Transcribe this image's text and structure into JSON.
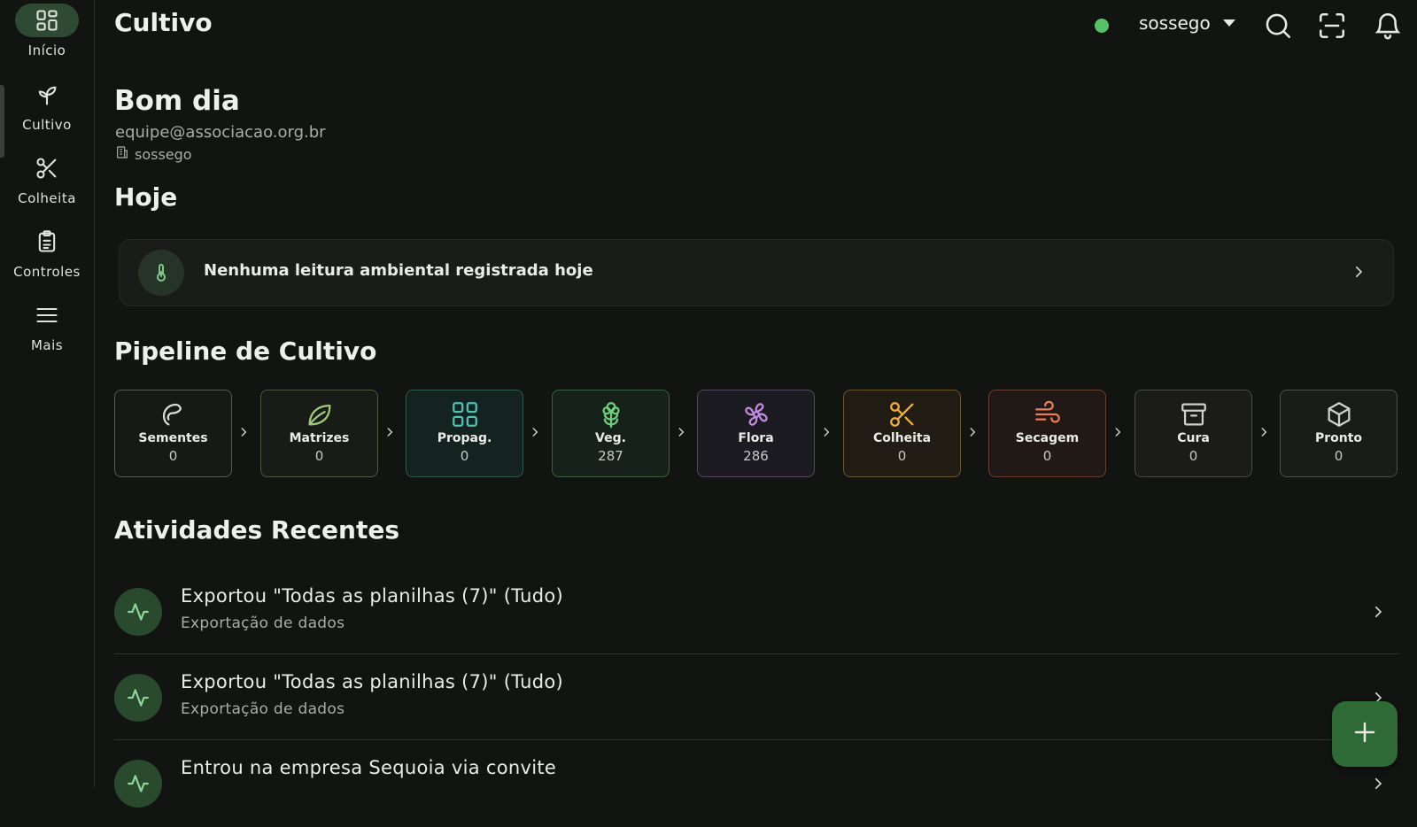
{
  "app": {
    "title": "Cultivo"
  },
  "nav": [
    {
      "label": "Início",
      "icon": "dashboard-icon",
      "active": true
    },
    {
      "label": "Cultivo",
      "icon": "sprout-icon"
    },
    {
      "label": "Colheita",
      "icon": "scissors-icon"
    },
    {
      "label": "Controles",
      "icon": "clipboard-icon"
    },
    {
      "label": "Mais",
      "icon": "menu-icon"
    }
  ],
  "topbar": {
    "status_color": "#55c26a",
    "org": "sossego"
  },
  "greeting": {
    "title": "Bom dia",
    "email": "equipe@associacao.org.br",
    "org": "sossego"
  },
  "today": {
    "heading": "Hoje",
    "message": "Nenhuma leitura ambiental registrada hoje"
  },
  "pipeline": {
    "heading": "Pipeline de Cultivo",
    "stages": [
      {
        "name": "Sementes",
        "count": "0",
        "icon": "seed-icon",
        "color": "#d9dcd6",
        "border": "#55595a",
        "bg": "#171917"
      },
      {
        "name": "Matrizes",
        "count": "0",
        "icon": "leaf-icon",
        "color": "#9cc97a",
        "border": "#4d5a3c",
        "bg": "#181b16"
      },
      {
        "name": "Propag.",
        "count": "0",
        "icon": "grid-icon",
        "color": "#4fc3b0",
        "border": "#2f5a52",
        "bg": "#142220"
      },
      {
        "name": "Veg.",
        "count": "287",
        "icon": "flower-icon",
        "color": "#6cd17e",
        "border": "#37603f",
        "bg": "#162219"
      },
      {
        "name": "Flora",
        "count": "286",
        "icon": "clover-icon",
        "color": "#c28ce0",
        "border": "#56475f",
        "bg": "#1d1b22"
      },
      {
        "name": "Colheita",
        "count": "0",
        "icon": "scissors-icon",
        "color": "#f0b03a",
        "border": "#6b5526",
        "bg": "#211d14"
      },
      {
        "name": "Secagem",
        "count": "0",
        "icon": "wind-icon",
        "color": "#ef7a57",
        "border": "#6a3e2f",
        "bg": "#211916"
      },
      {
        "name": "Cura",
        "count": "0",
        "icon": "archive-icon",
        "color": "#d0cfcb",
        "border": "#4a4a48",
        "bg": "#1b1b1a"
      },
      {
        "name": "Pronto",
        "count": "0",
        "icon": "box-icon",
        "color": "#d0d3cd",
        "border": "#4a504a",
        "bg": "#1a1c1a"
      }
    ]
  },
  "activities": {
    "heading": "Atividades Recentes",
    "items": [
      {
        "title": "Exportou \"Todas as planilhas (7)\" (Tudo)",
        "subtitle": "Exportação de dados"
      },
      {
        "title": "Exportou \"Todas as planilhas (7)\" (Tudo)",
        "subtitle": "Exportação de dados"
      },
      {
        "title": "Entrou na empresa Sequoia via convite",
        "subtitle": ""
      }
    ]
  }
}
